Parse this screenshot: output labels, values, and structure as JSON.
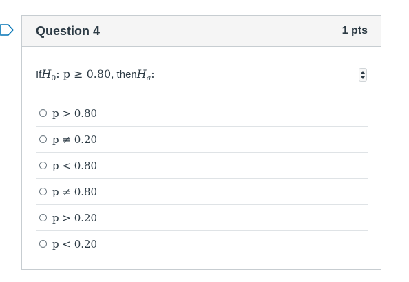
{
  "question": {
    "title": "Question 4",
    "points": "1 pts",
    "prompt": {
      "lead": "If ",
      "h0_symbol": "H",
      "h0_sub": "0",
      "h0_expr": ": p ≥ 0.80",
      "middle": ", then ",
      "ha_symbol": "H",
      "ha_sub": "a",
      "end": ":"
    },
    "answers": [
      {
        "text": "p > 0.80"
      },
      {
        "text": "p ≠ 0.20"
      },
      {
        "text": "p < 0.80"
      },
      {
        "text": "p ≠ 0.80"
      },
      {
        "text": "p > 0.20"
      },
      {
        "text": "p < 0.20"
      }
    ]
  },
  "icons": {
    "bookmark": "bookmark-outline-icon",
    "stepper": "up-down-arrows-icon",
    "radio": "radio-button-icon"
  },
  "colors": {
    "accent": "#0374b5",
    "text": "#2d3b45",
    "border": "#c7cdd1",
    "header_bg": "#f5f5f5"
  }
}
